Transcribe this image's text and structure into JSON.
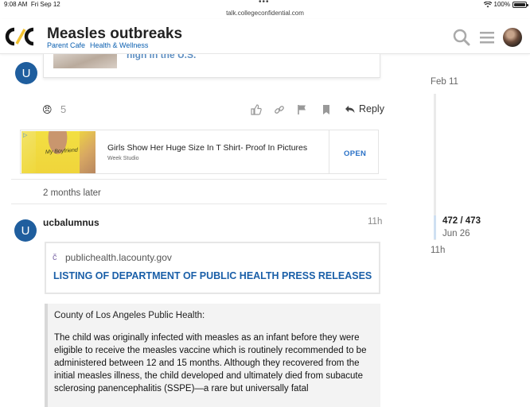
{
  "statusbar": {
    "time": "9:08 AM",
    "date": "Fri Sep 12",
    "battery": "100%"
  },
  "urlbar": {
    "url": "talk.collegeconfidential.com"
  },
  "header": {
    "logo": "C/C",
    "title": "Measles outbreaks",
    "breadcrumbs": [
      "Parent Cafe",
      "Health & Wellness"
    ]
  },
  "post1": {
    "avatar_letter": "U",
    "card_title": "high in the U.S.",
    "reaction_emoji": "😠",
    "reaction_count": "5",
    "reply_label": "Reply"
  },
  "ad": {
    "badge": "▷",
    "shirt_text": "My Boyfriend",
    "headline": "Girls Show Her Huge Size In T Shirt- Proof In Pictures",
    "source": "Week Studio",
    "cta": "OPEN"
  },
  "time_gap": "2 months later",
  "post2": {
    "avatar_letter": "U",
    "username": "ucbalumnus",
    "age": "11h",
    "onebox_domain": "publichealth.lacounty.gov",
    "onebox_title": "LISTING OF DEPARTMENT OF PUBLIC HEALTH PRESS RELEASES",
    "quote_heading": "County of Los Angeles Public Health:",
    "quote_body": "The child was originally infected with measles as an infant before they were eligible to receive the measles vaccine which is routinely recommended to be administered between 12 and 15 months. Although they recovered from the initial measles illness, the child developed and ultimately died from subacute sclerosing panencephalitis (SSPE)—a rare but universally fatal"
  },
  "timeline": {
    "top_date": "Feb 11",
    "position": "472 / 473",
    "position_date": "Jun 26",
    "bottom_date": "11h"
  },
  "colors": {
    "link": "#1a5fa8",
    "avatar": "#1f5e9e",
    "ad_cta": "#2b72c7"
  }
}
